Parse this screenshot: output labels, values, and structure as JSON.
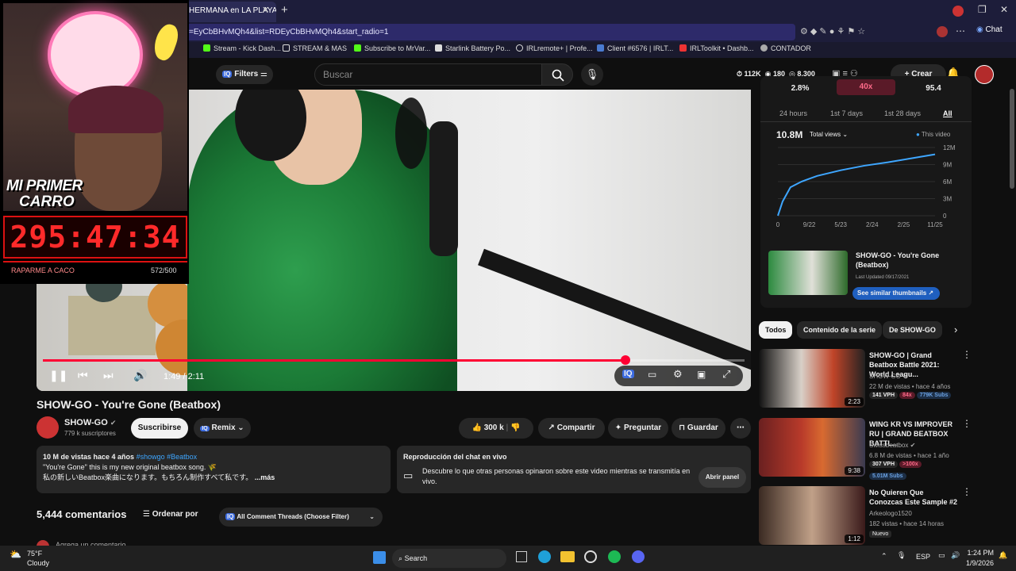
{
  "browser": {
    "tab_title": "HERMANA en LA PLAYA N",
    "url": "=EyCbBHvMQh4&list=RDEyCbBHvMQh4&start_radio=1",
    "copilot_label": "Chat",
    "bookmarks": [
      "Stream - Kick Dash...",
      "STREAM & MAS",
      "Subscribe to MrVar...",
      "Starlink Battery Po...",
      "IRLremote+ | Profe...",
      "Client #6576 | IRLT...",
      "IRLToolkit • Dashb...",
      "CONTADOR"
    ]
  },
  "youtube": {
    "filters_label": "Filters",
    "search_placeholder": "Buscar",
    "header_stats": [
      "112K",
      "180",
      "8,300"
    ],
    "create_label": "Crear"
  },
  "overlay": {
    "banner1": "MI PRIMER",
    "banner2": "CARRO",
    "timer": "295:47:34",
    "label": "RAPARME A CACO",
    "count": "572/500"
  },
  "player": {
    "time": "1:49 / 2:11",
    "progress": 0.83
  },
  "video": {
    "title": "SHOW-GO - You're Gone (Beatbox)",
    "channel": "SHOW-GO",
    "subscribers": "779 k suscriptores",
    "subscribe_label": "Suscribirse",
    "remix_label": "Remix",
    "likes": "300 k",
    "share_label": "Compartir",
    "ask_label": "Preguntar",
    "save_label": "Guardar",
    "desc_meta": "10 M de vistas  hace 4 años",
    "desc_tags": "#showgo #Beatbox",
    "desc_line1": "\"You're Gone\" this is my new original beatbox song. 🌾",
    "desc_line2": "私の新しいBeatbox楽曲になります。もちろん制作すべて私です。",
    "desc_more": "...más",
    "chat_title": "Reproducción del chat en vivo",
    "chat_text": "Descubre lo que otras personas opinaron sobre este video mientras se transmitía en vivo.",
    "chat_btn": "Abrir panel",
    "comments_count": "5,444 comentarios",
    "sort_label": "Ordenar por",
    "thread_filter": "All Comment Threads (Choose Filter)",
    "add_comment": "Agrega un comentario..."
  },
  "stats_panel": {
    "top_values": [
      "2.8%",
      "40x",
      "95.4"
    ],
    "ranges": [
      "24 hours",
      "1st 7 days",
      "1st 28 days",
      "All"
    ],
    "total": "10.8M",
    "total_label": "Total views",
    "legend": "This video",
    "chart_data": {
      "type": "line",
      "x_ticks": [
        "0",
        "9/22",
        "5/23",
        "2/24",
        "2/25",
        "11/25"
      ],
      "y_ticks": [
        "0",
        "3M",
        "6M",
        "9M",
        "12M"
      ],
      "ylim": [
        0,
        12
      ],
      "x": [
        0,
        0.03,
        0.08,
        0.15,
        0.25,
        0.4,
        0.55,
        0.7,
        0.85,
        1.0
      ],
      "values": [
        0,
        2.5,
        5.0,
        6.0,
        7.0,
        8.0,
        8.8,
        9.4,
        10.1,
        10.8
      ]
    },
    "thumb_title": "SHOW-GO - You're Gone (Beatbox)",
    "last_updated": "Last Updated 09/17/2021",
    "similar_btn": "See similar thumbnails"
  },
  "chips": [
    "Todos",
    "Contenido de la serie",
    "De SHOW-GO"
  ],
  "recommendations": [
    {
      "title": "SHOW-GO | Grand Beatbox Battle 2021: World Leagu...",
      "channel": "SHOW-GO",
      "meta": "22 M de vistas • hace 4 años",
      "badges": [
        "141 VPH",
        "84x",
        "779K Subs"
      ],
      "duration": "2:23"
    },
    {
      "title": "WING KR VS IMPROVER RU | GRAND BEATBOX BATTL...",
      "channel": "Swissbeatbox",
      "meta": "6.8 M de vistas • hace 1 año",
      "badges": [
        "307 VPH",
        ">100x",
        "5.01M Subs"
      ],
      "duration": "9:38"
    },
    {
      "title": "No Quieren Que Conozcas Este Sample #2",
      "channel": "Arkeologo1520",
      "meta": "182 vistas • hace 14 horas",
      "badges": [
        "Nuevo"
      ],
      "duration": "1:12"
    }
  ],
  "taskbar": {
    "temp": "75°F",
    "weather": "Cloudy",
    "search": "Search",
    "lang": "ESP",
    "time": "1:24 PM",
    "date": "1/9/2026"
  }
}
